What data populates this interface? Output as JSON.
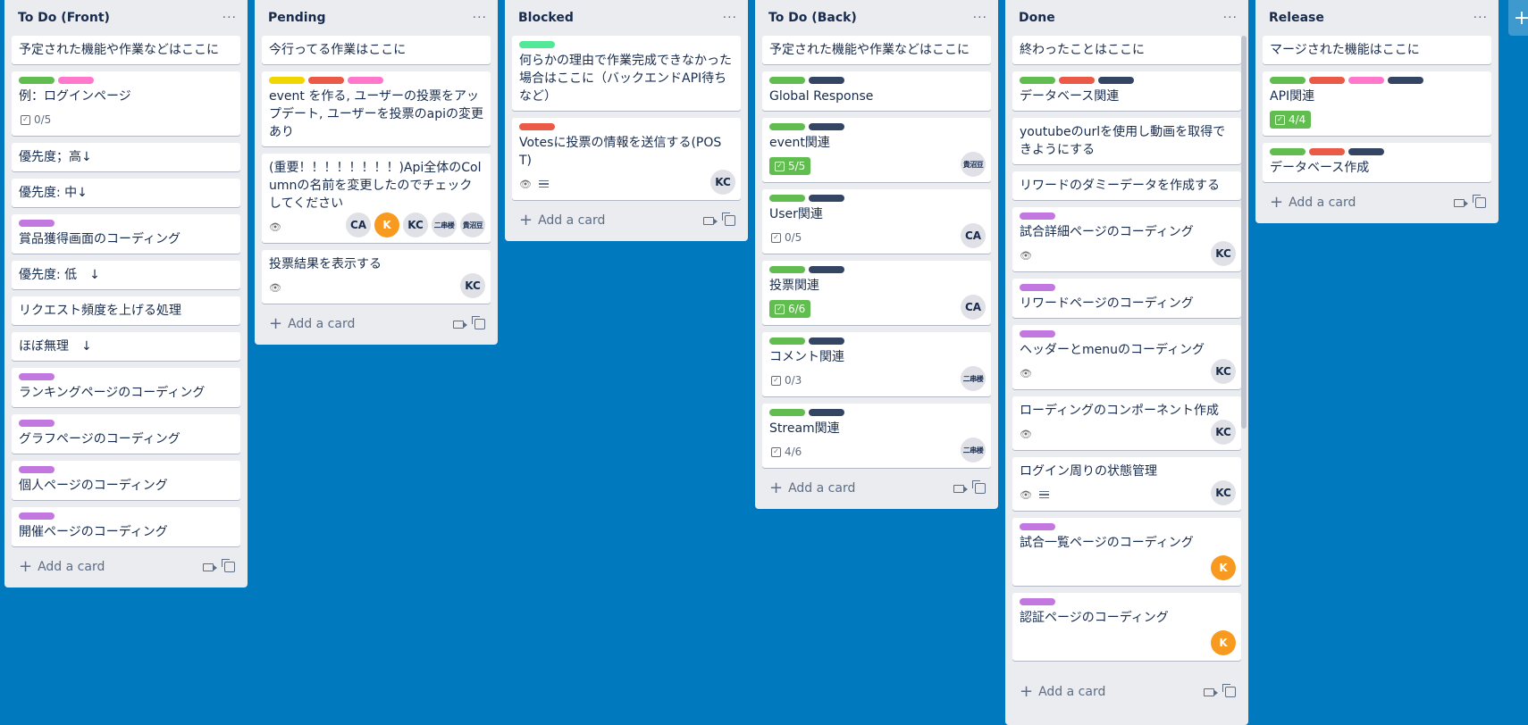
{
  "colors": {
    "green": "#61bd4f",
    "pink": "#ff78cb",
    "yellow": "#f2d600",
    "red": "#eb5a46",
    "purple": "#c377e0",
    "navy": "#344563",
    "lime": "#51e898",
    "board_bg": "#0079bf"
  },
  "lists": [
    {
      "title": "To Do (Front)",
      "menu": "···",
      "add_card": "Add a card",
      "cards": [
        {
          "title": "予定された機能や作業などはここに",
          "labels": []
        },
        {
          "title": "例：ログインページ",
          "labels": [
            "green",
            "pink"
          ],
          "checklist": "0/5",
          "checklist_done": false
        },
        {
          "title": "優先度；高↓",
          "labels": []
        },
        {
          "title": "優先度: 中↓",
          "labels": []
        },
        {
          "title": "賞品獲得画面のコーディング",
          "labels": [
            "purple"
          ]
        },
        {
          "title": "優先度: 低　↓",
          "labels": []
        },
        {
          "title": "リクエスト頻度を上げる処理",
          "labels": []
        },
        {
          "title": "ほぼ無理　↓",
          "labels": []
        },
        {
          "title": "ランキングページのコーディング",
          "labels": [
            "purple"
          ]
        },
        {
          "title": "グラフページのコーディング",
          "labels": [
            "purple"
          ]
        },
        {
          "title": "個人ページのコーディング",
          "labels": [
            "purple"
          ]
        },
        {
          "title": "開催ページのコーディング",
          "labels": [
            "purple"
          ]
        }
      ]
    },
    {
      "title": "Pending",
      "menu": "···",
      "add_card": "Add a card",
      "cards": [
        {
          "title": "今行ってる作業はここに",
          "labels": []
        },
        {
          "title": "event を作る, ユーザーの投票をアップデート, ユーザーを投票のapiの変更あり",
          "labels": [
            "yellow",
            "red",
            "pink"
          ]
        },
        {
          "title": "(重要！！！！！！！！)Api全体のColumnの名前を変更したのでチェックしてください",
          "labels": [],
          "watch": true,
          "members": [
            "CA",
            "K",
            "KC",
            "二串楼",
            "貴沼豆"
          ]
        },
        {
          "title": "投票結果を表示する",
          "labels": [],
          "watch": true,
          "members": [
            "KC"
          ]
        }
      ]
    },
    {
      "title": "Blocked",
      "menu": "···",
      "add_card": "Add a card",
      "cards": [
        {
          "title": "何らかの理由で作業完成できなかった場合はここに（バックエンドAPI待ちなど）",
          "labels": [
            "lime"
          ]
        },
        {
          "title": "Votesに投票の情報を送信する(POST)",
          "labels": [
            "red"
          ],
          "watch": true,
          "description": true,
          "members": [
            "KC"
          ]
        }
      ]
    },
    {
      "title": "To Do (Back)",
      "menu": "···",
      "add_card": "Add a card",
      "cards": [
        {
          "title": "予定された機能や作業などはここに",
          "labels": []
        },
        {
          "title": "Global Response",
          "labels": [
            "green",
            "navy"
          ]
        },
        {
          "title": "event関連",
          "labels": [
            "green",
            "navy"
          ],
          "checklist": "5/5",
          "checklist_done": true,
          "members": [
            "貴沼豆"
          ]
        },
        {
          "title": "User関連",
          "labels": [
            "green",
            "navy"
          ],
          "checklist": "0/5",
          "checklist_done": false,
          "members": [
            "CA"
          ]
        },
        {
          "title": "投票関連",
          "labels": [
            "green",
            "navy"
          ],
          "checklist": "6/6",
          "checklist_done": true,
          "members": [
            "CA"
          ]
        },
        {
          "title": "コメント関連",
          "labels": [
            "green",
            "navy"
          ],
          "checklist": "0/3",
          "checklist_done": false,
          "members": [
            "二串楼"
          ]
        },
        {
          "title": "Stream関連",
          "labels": [
            "green",
            "navy"
          ],
          "checklist": "4/6",
          "checklist_done": false,
          "members": [
            "二串楼"
          ]
        }
      ]
    },
    {
      "title": "Done",
      "menu": "···",
      "add_card": "Add a card",
      "cards": [
        {
          "title": "終わったことはここに",
          "labels": []
        },
        {
          "title": "データベース関連",
          "labels": [
            "green",
            "red",
            "navy"
          ]
        },
        {
          "title": "youtubeのurlを使用し動画を取得できようにする",
          "labels": []
        },
        {
          "title": "リワードのダミーデータを作成する",
          "labels": []
        },
        {
          "title": "試合詳細ページのコーディング",
          "labels": [
            "purple"
          ],
          "watch": true,
          "members": [
            "KC"
          ]
        },
        {
          "title": "リワードページのコーディング",
          "labels": [
            "purple"
          ]
        },
        {
          "title": "ヘッダーとmenuのコーディング",
          "labels": [
            "purple"
          ],
          "watch": true,
          "members": [
            "KC"
          ]
        },
        {
          "title": "ローディングのコンポーネント作成",
          "labels": [],
          "watch": true,
          "members": [
            "KC"
          ]
        },
        {
          "title": "ログイン周りの状態管理",
          "labels": [],
          "watch": true,
          "description": true,
          "members": [
            "KC"
          ]
        },
        {
          "title": "試合一覧ページのコーディング",
          "labels": [
            "purple"
          ],
          "members": [
            "K"
          ]
        },
        {
          "title": "認証ページのコーディング",
          "labels": [
            "purple"
          ],
          "members": [
            "K"
          ]
        }
      ]
    },
    {
      "title": "Release",
      "menu": "···",
      "add_card": "Add a card",
      "cards": [
        {
          "title": "マージされた機能はここに",
          "labels": []
        },
        {
          "title": "API関連",
          "labels": [
            "green",
            "red",
            "pink",
            "navy"
          ],
          "checklist": "4/4",
          "checklist_done": true
        },
        {
          "title": "データベース作成",
          "labels": [
            "green",
            "red",
            "navy"
          ]
        }
      ]
    }
  ],
  "add_list": "+"
}
